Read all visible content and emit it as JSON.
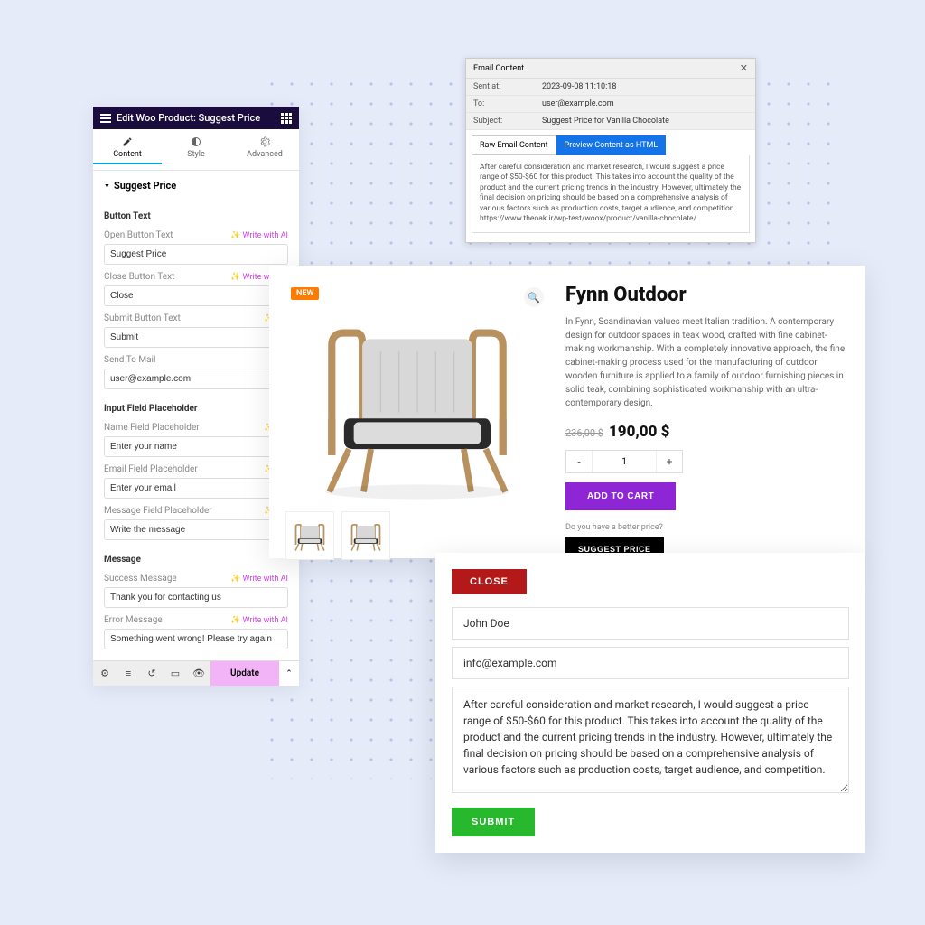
{
  "editor": {
    "title": "Edit Woo Product: Suggest Price",
    "tabs": {
      "content": "Content",
      "style": "Style",
      "advanced": "Advanced"
    },
    "section_title": "Suggest Price",
    "groups": {
      "button_text": "Button Text",
      "input_placeholder": "Input Field Placeholder",
      "message": "Message"
    },
    "fields": {
      "open_btn": {
        "label": "Open Button Text",
        "value": "Suggest Price"
      },
      "close_btn": {
        "label": "Close Button Text",
        "value": "Close"
      },
      "submit_btn": {
        "label": "Submit Button Text",
        "value": "Submit"
      },
      "send_to": {
        "label": "Send To Mail",
        "value": "user@example.com"
      },
      "name_ph": {
        "label": "Name Field Placeholder",
        "value": "Enter your name"
      },
      "email_ph": {
        "label": "Email Field Placeholder",
        "value": "Enter your email"
      },
      "message_ph": {
        "label": "Message Field Placeholder",
        "value": "Write the message"
      },
      "success_msg": {
        "label": "Success Message",
        "value": "Thank you for contacting us"
      },
      "error_msg": {
        "label": "Error Message",
        "value": "Something went wrong! Please try again"
      }
    },
    "write_ai": "✨ Write with AI",
    "write_ai_short": "✨ Wri",
    "write_ai_mid": "✨ Write with AI",
    "update": "Update"
  },
  "email": {
    "header": "Email Content",
    "sent_at_label": "Sent at:",
    "sent_at": "2023-09-08 11:10:18",
    "to_label": "To:",
    "to": "user@example.com",
    "subject_label": "Subject:",
    "subject": "Suggest Price for Vanilla Chocolate",
    "tab_raw": "Raw Email Content",
    "tab_preview": "Preview Content as HTML",
    "body": "After careful consideration and market research, I would suggest a price range of $50-$60 for this product. This takes into account the quality of the product and the current pricing trends in the industry. However, ultimately the final decision on pricing should be based on a comprehensive analysis of various factors such as production costs, target audience, and competition. https://www.theoak.ir/wp-test/woox/product/vanilla-chocolate/"
  },
  "product": {
    "new_badge": "NEW",
    "title": "Fynn Outdoor",
    "description": "In Fynn, Scandinavian values meet Italian tradition. A contemporary design for outdoor spaces in teak wood, crafted with fine cabinet-making workmanship. With a completely innovative approach, the fine cabinet-making process used for the manufacturing of outdoor wooden furniture is applied to a family of outdoor furnishing pieces in solid teak, combining sophisticated workmanship with an ultra-contemporary design.",
    "old_price": "236,00 $",
    "new_price": "190,00 $",
    "qty": "1",
    "add_to_cart": "ADD TO CART",
    "better_price_q": "Do you have a better price?",
    "suggest_price": "SUGGEST PRICE"
  },
  "form": {
    "close": "CLOSE",
    "name": "John Doe",
    "email": "info@example.com",
    "message": "After careful consideration and market research, I would suggest a price range of $50-$60 for this product. This takes into account the quality of the product and the current pricing trends in the industry. However, ultimately the final decision on pricing should be based on a comprehensive analysis of various factors such as production costs, target audience, and competition.",
    "submit": "SUBMIT"
  }
}
